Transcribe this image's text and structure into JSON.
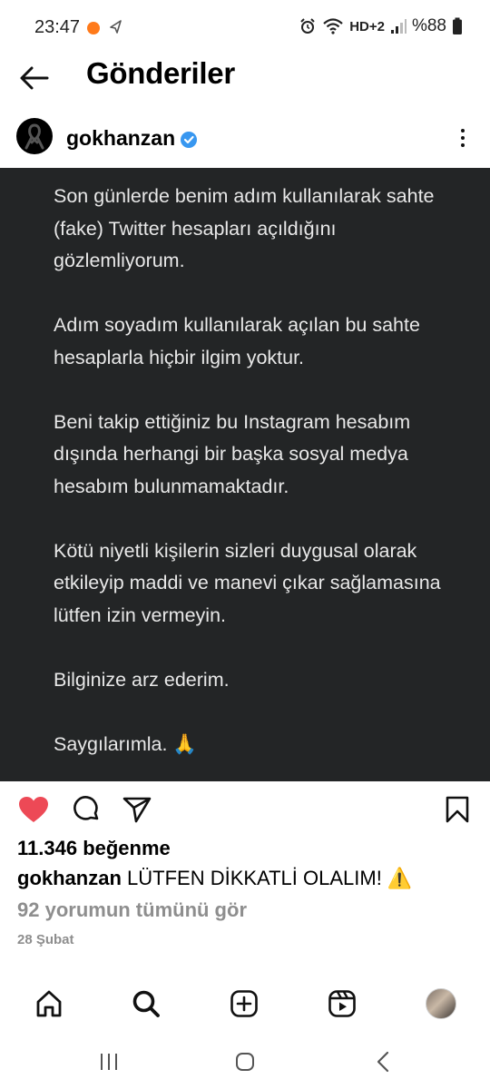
{
  "status_bar": {
    "time": "23:47",
    "battery": "%88",
    "signal_label": "HD+2",
    "colors": {
      "notification_dot": "#ff7a1a"
    }
  },
  "header": {
    "title": "Gönderiler",
    "back_icon": "arrow-left-icon"
  },
  "post": {
    "username": "gokhanzan",
    "verified_icon": "verified-badge-icon",
    "more_icon": "more-vertical-icon",
    "image_text": {
      "p1": "Son günlerde benim adım kullanılarak sahte (fake) Twitter hesapları açıldığını gözlemliyorum.",
      "p2": "Adım soyadım kullanılarak açılan bu sahte hesaplarla hiçbir ilgim yoktur.",
      "p3": "Beni takip ettiğiniz bu Instagram hesabım dışında herhangi bir başka sosyal medya hesabım bulunmamaktadır.",
      "p4": "Kötü niyetli kişilerin sizleri duygusal olarak etkileyip maddi ve manevi çıkar sağlamasına lütfen izin vermeyin.",
      "p5": "Bilginize arz ederim.",
      "p6": "Saygılarımla. 🙏"
    },
    "likes": "11.346 beğenme",
    "caption_user": "gokhanzan",
    "caption_text": "LÜTFEN DİKKATLİ OLALIM! ⚠️",
    "comments_link": "92 yorumun tümünü gör",
    "date": "28 Şubat",
    "colors": {
      "like": "#ed4956",
      "image_bg": "#232526",
      "verified": "#3897f0"
    }
  },
  "actions": {
    "like_icon": "heart-filled-icon",
    "comment_icon": "comment-icon",
    "share_icon": "send-icon",
    "save_icon": "bookmark-icon"
  },
  "bottom_nav": {
    "items": [
      "home-icon",
      "search-icon",
      "create-icon",
      "reels-icon",
      "profile-avatar"
    ]
  },
  "system_nav": {
    "items": [
      "recents-icon",
      "home-button-icon",
      "back-icon"
    ]
  }
}
